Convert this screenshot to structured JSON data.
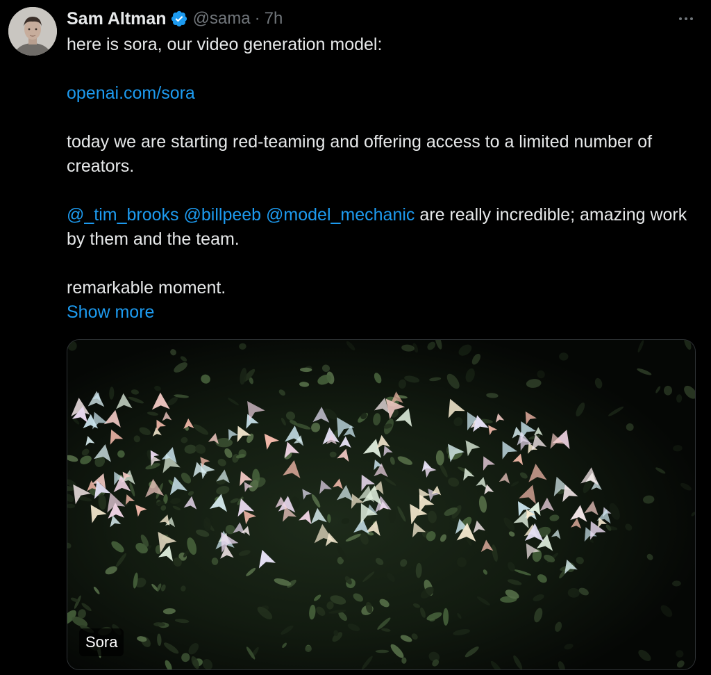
{
  "author": {
    "name": "Sam Altman",
    "handle": "@sama",
    "separator": "·",
    "time": "7h"
  },
  "tweet": {
    "line1": "here is sora, our video generation model:",
    "link": "openai.com/sora",
    "line3": "today we are starting red-teaming and offering access to a limited number of creators.",
    "mentions": [
      "@_tim_brooks",
      "@billpeeb",
      "@model_mechanic"
    ],
    "line4_rest": " are really incredible; amazing work by them and the team.",
    "line5": "remarkable moment.",
    "show_more": "Show more"
  },
  "media": {
    "label": "Sora"
  },
  "icons": {
    "verified": "verified-badge-icon",
    "more": "more-options-icon"
  },
  "colors": {
    "background": "#000000",
    "text": "#e7e9ea",
    "muted": "#71767b",
    "link": "#1d9bf0",
    "verified": "#1d9bf0"
  }
}
